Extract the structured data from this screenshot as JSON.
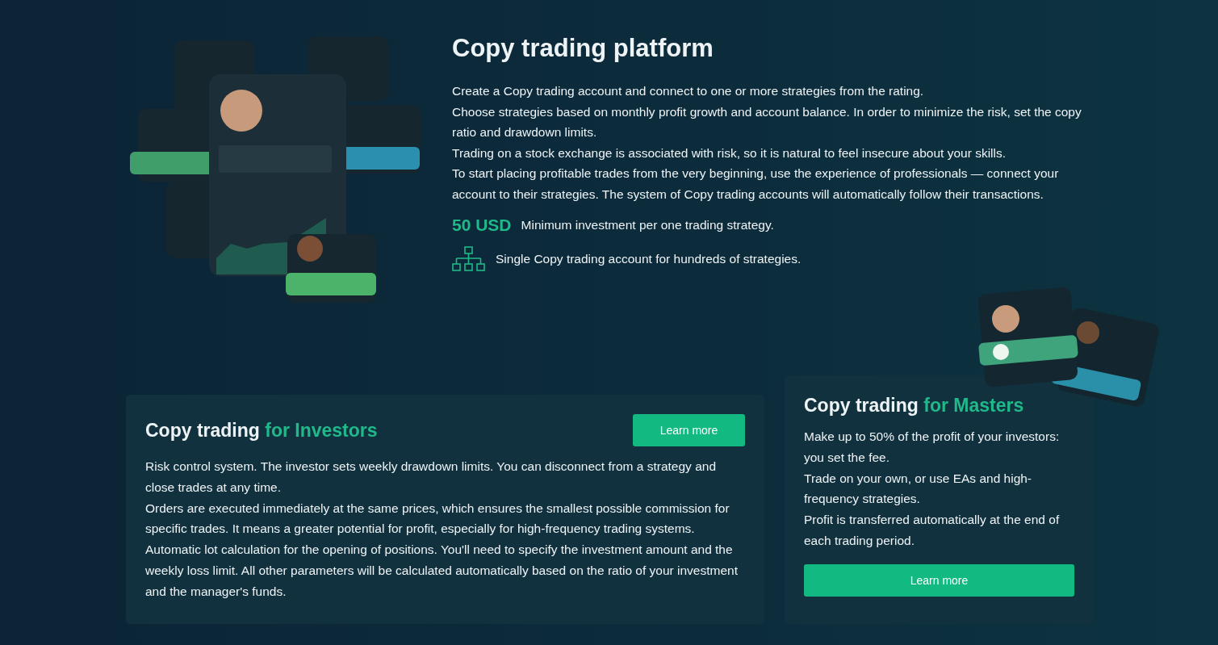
{
  "heading": "Copy trading platform",
  "paragraphs": [
    "Create a Copy trading account and connect to one or more strategies from the rating.",
    "Choose strategies based on monthly profit growth and account balance. In order to minimize the risk, set the copy ratio and drawdown limits.",
    "Trading on a stock exchange is associated with risk, so it is natural to feel insecure about your skills.",
    "To start placing profitable trades from the very beginning, use the experience of professionals — connect your account to their strategies. The system of Copy trading accounts will automatically follow their transactions."
  ],
  "highlights": [
    {
      "kind": "amount",
      "value": "50 USD",
      "text": "Minimum investment per one trading strategy."
    },
    {
      "kind": "hierarchy",
      "text": "Single Copy trading account for hundreds of strategies."
    }
  ],
  "cards": [
    {
      "kind": "wide",
      "title": "Copy trading",
      "accent": "for Investors",
      "button": "Learn more",
      "paragraphs": [
        "Risk control system. The investor sets weekly drawdown limits. You can disconnect from a strategy and close trades at any time.",
        "Orders are executed immediately at the same prices, which ensures the smallest possible commission for specific trades. It means a greater potential for profit, especially for high-frequency trading systems.",
        "Automatic lot calculation for the opening of positions. You'll need to specify the investment amount and the weekly loss limit. All other parameters will be calculated automatically based on the ratio of your investment and the manager's funds."
      ]
    },
    {
      "kind": "narrow",
      "title": "Copy trading",
      "accent": "for Masters",
      "button": "Learn more",
      "paragraphs": [
        "Make up to 50% of the profit of your investors: you set the fee.",
        "Trade on your own, or use EAs and high-frequency strategies.",
        "Profit is transferred automatically at the end of each trading period."
      ]
    }
  ]
}
